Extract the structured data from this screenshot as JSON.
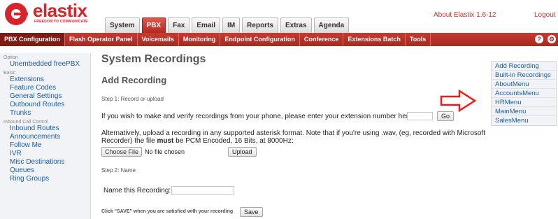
{
  "brand": {
    "logo_text": "elastix",
    "tagline": "FREEDOM TO COMMUNICATE"
  },
  "header": {
    "main_tabs": [
      {
        "label": "System"
      },
      {
        "label": "PBX"
      },
      {
        "label": "Fax"
      },
      {
        "label": "Email"
      },
      {
        "label": "IM"
      },
      {
        "label": "Reports"
      },
      {
        "label": "Extras"
      },
      {
        "label": "Agenda"
      }
    ],
    "active_tab": "PBX",
    "about": "About Elastix 1.6-12",
    "logout": "Logout"
  },
  "subnav": {
    "items": [
      {
        "label": "PBX Configuration"
      },
      {
        "label": "Flash Operator Panel"
      },
      {
        "label": "Voicemails"
      },
      {
        "label": "Monitoring"
      },
      {
        "label": "Endpoint Configuration"
      },
      {
        "label": "Conference"
      },
      {
        "label": "Extensions Batch"
      },
      {
        "label": "Tools"
      }
    ],
    "icons": [
      "help-icon",
      "settings-icon"
    ]
  },
  "sidebar": {
    "sections": [
      {
        "title": "Option",
        "items": [
          "Unembedded freePBX"
        ]
      },
      {
        "title": "Basic",
        "items": [
          "Extensions",
          "Feature Codes",
          "General Settings",
          "Outbound Routes",
          "Trunks"
        ]
      },
      {
        "title": "Inbound Call Control",
        "items": [
          "Inbound Routes",
          "Announcements",
          "Follow Me",
          "IVR",
          "Misc Destinations",
          "Queues",
          "Ring Groups"
        ]
      }
    ]
  },
  "main": {
    "title": "System Recordings",
    "subtitle": "Add Recording",
    "step1": "Step 1: Record or upload",
    "phone_text": "If you wish to make and verify recordings from your phone, please enter your extension number here:",
    "go_button": "Go",
    "upload_text_1": "Alternatively, upload a recording in any supported asterisk format. Note that if you're using .wav, (eg, recorded with Microsoft",
    "upload_text_2a": "Recorder) the file ",
    "upload_text_2b": "must",
    "upload_text_2c": " be PCM Encoded, 16 Bits, at 8000Hz:",
    "choose_file": "Choose File",
    "no_file": "No file chosen",
    "upload_button": "Upload",
    "step2": "Step 2: Name",
    "name_label": "Name this Recording:",
    "save_hint": "Click \"SAVE\" when you are satisfied with your recording",
    "save_button": "Save"
  },
  "right_panel": {
    "items": [
      "Add Recording",
      "Built-in Recordings",
      "AboutMenu",
      "AccountsMenu",
      "HRMenu",
      "MainMenu",
      "SalesMenu"
    ]
  },
  "colors": {
    "brand_red": "#d8232a",
    "link_blue": "#1a5ea8",
    "arrow_red": "#e0201f"
  }
}
